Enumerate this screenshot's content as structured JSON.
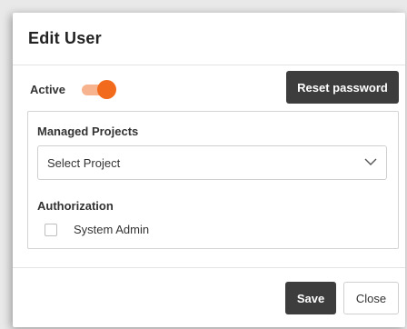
{
  "dialog": {
    "title": "Edit User"
  },
  "active": {
    "label": "Active",
    "enabled": true
  },
  "reset_password": {
    "label": "Reset password"
  },
  "managed_projects": {
    "label": "Managed Projects",
    "select_value": "Select Project"
  },
  "authorization": {
    "label": "Authorization",
    "system_admin_label": "System Admin",
    "system_admin_checked": false
  },
  "footer": {
    "save_label": "Save",
    "close_label": "Close"
  },
  "colors": {
    "accent": "#f26a1b",
    "accent_light": "#f6b38d",
    "dark_button": "#3d3d3d"
  },
  "icons": {
    "select_chevron": "chevron-down-icon"
  }
}
